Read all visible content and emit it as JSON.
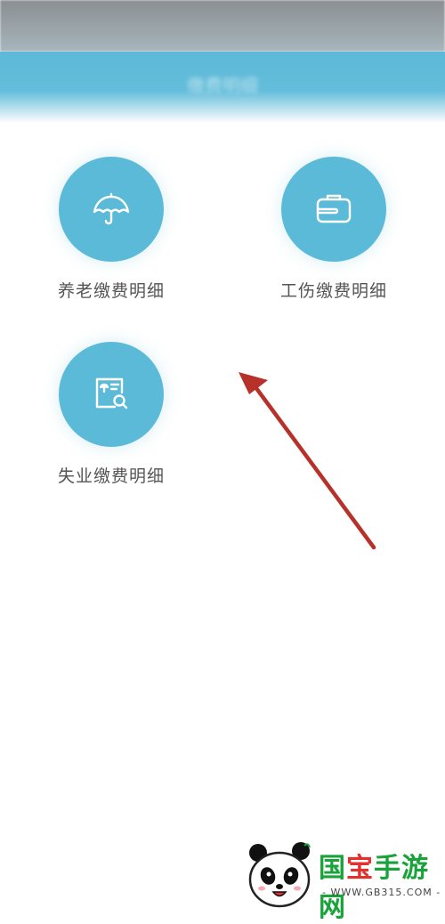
{
  "header": {
    "title": "缴费明细"
  },
  "tiles": [
    {
      "label": "养老缴费明细",
      "icon": "umbrella-icon"
    },
    {
      "label": "工伤缴费明细",
      "icon": "briefcase-icon"
    },
    {
      "label": "失业缴费明细",
      "icon": "document-search-icon"
    }
  ],
  "watermark": {
    "title_part1": "国",
    "title_part2": "宝",
    "title_part3": "手游网",
    "url": "- WWW.GB315.COM -"
  },
  "colors": {
    "accent": "#5cbad9",
    "arrow": "#b8302a",
    "watermark_green": "#1aa33a"
  }
}
